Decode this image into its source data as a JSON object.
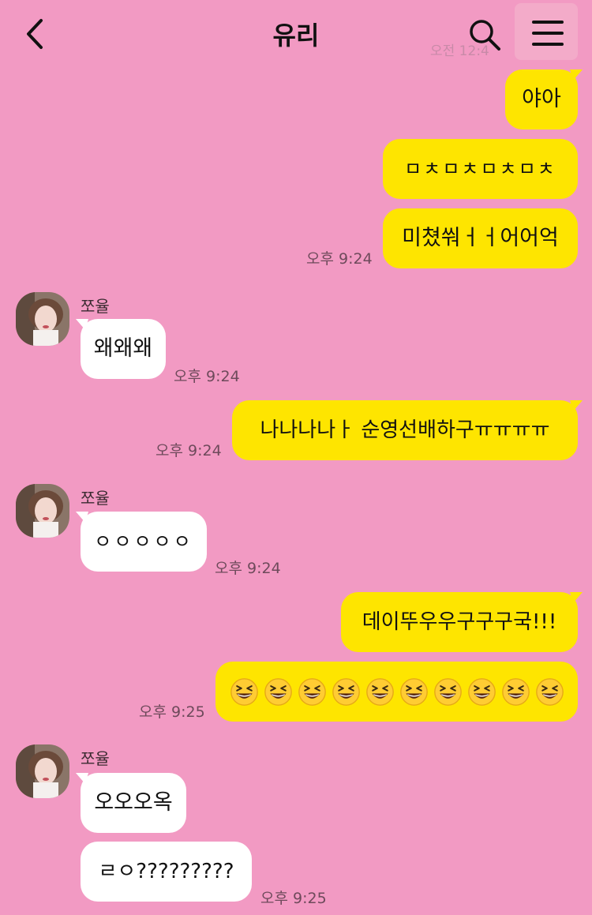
{
  "header": {
    "title": "유리",
    "faded_date": "오전 12:4"
  },
  "messages": {
    "m1": "야아",
    "m2": "ㅁㅊㅁㅊㅁㅊㅁㅊ",
    "m3": "미쳤쒀ㅓㅓ어어억",
    "t3": "오후 9:24",
    "r1_sender": "쪼율",
    "r1": "왜왜왜",
    "rt1": "오후 9:24",
    "m4": "나나나나ㅏ 순영선배하구ㅠㅠㅠㅠ",
    "t4": "오후 9:24",
    "r2_sender": "쪼율",
    "r2": "ㅇㅇㅇㅇㅇ",
    "rt2": "오후 9:24",
    "m5": "데이뚜우우구구구국!!!",
    "t6": "오후 9:25",
    "r3_sender": "쪼율",
    "r3a": "오오오옥",
    "r3b": "ㄹㅇ?????????",
    "rt3": "오후 9:25"
  },
  "emoji": {
    "name": "grinning-squinting-face-icon",
    "count": 10
  },
  "colors": {
    "background": "#f29ac3",
    "my_bubble": "#fee500",
    "their_bubble": "#ffffff",
    "timestamp": "#6e4a5b"
  }
}
